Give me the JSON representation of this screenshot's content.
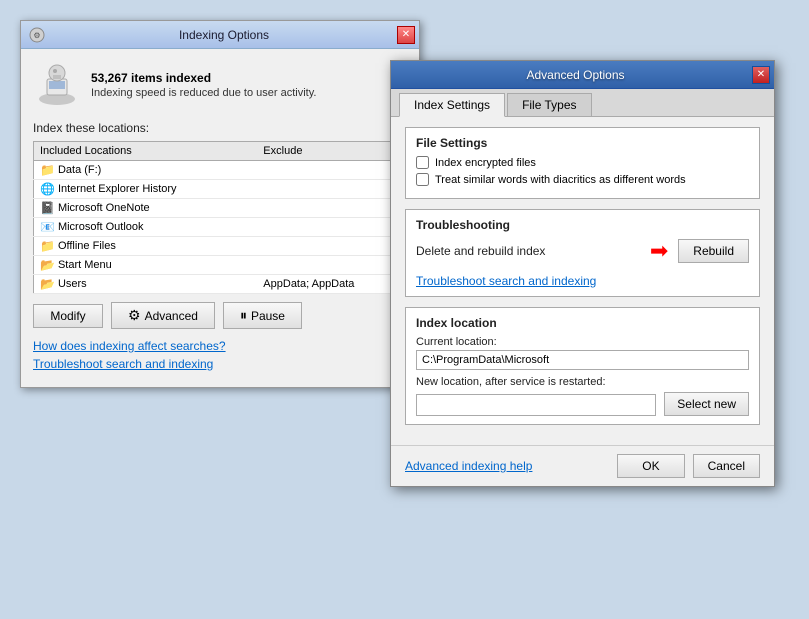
{
  "indexing_window": {
    "title": "Indexing Options",
    "close_btn": "✕",
    "items_indexed": "53,267 items indexed",
    "status_msg": "Indexing speed is reduced due to user activity.",
    "section_label": "Index these locations:",
    "col_included": "Included Locations",
    "col_exclude": "Exclude",
    "locations": [
      {
        "name": "Data (F:)",
        "icon": "folder",
        "exclude": ""
      },
      {
        "name": "Internet Explorer History",
        "icon": "ie",
        "exclude": ""
      },
      {
        "name": "Microsoft OneNote",
        "icon": "onenote",
        "exclude": ""
      },
      {
        "name": "Microsoft Outlook",
        "icon": "outlook",
        "exclude": ""
      },
      {
        "name": "Offline Files",
        "icon": "folder",
        "exclude": ""
      },
      {
        "name": "Start Menu",
        "icon": "folder-yellow",
        "exclude": ""
      },
      {
        "name": "Users",
        "icon": "folder-yellow",
        "exclude": "AppData; AppData"
      }
    ],
    "btn_modify": "Modify",
    "btn_advanced": "Advanced",
    "btn_advanced_icon": "⚙",
    "btn_pause": "Pause",
    "btn_pause_icon": "⏸",
    "link_how": "How does indexing affect searches?",
    "link_troubleshoot": "Troubleshoot search and indexing"
  },
  "advanced_window": {
    "title": "Advanced Options",
    "close_btn": "✕",
    "tabs": [
      {
        "label": "Index Settings",
        "active": true
      },
      {
        "label": "File Types",
        "active": false
      }
    ],
    "file_settings": {
      "title": "File Settings",
      "checkbox1_label": "Index encrypted files",
      "checkbox1_checked": false,
      "checkbox2_label": "Treat similar words with diacritics as different words",
      "checkbox2_checked": false
    },
    "troubleshooting": {
      "title": "Troubleshooting",
      "rebuild_label": "Delete and rebuild index",
      "rebuild_btn": "Rebuild",
      "link_troubleshoot": "Troubleshoot search and indexing"
    },
    "index_location": {
      "title": "Index location",
      "current_label": "Current location:",
      "current_value": "C:\\ProgramData\\Microsoft",
      "new_label": "New location, after service is restarted:",
      "new_value": "",
      "btn_select_new": "Select new"
    },
    "footer": {
      "link": "Advanced indexing help",
      "btn_ok": "OK",
      "btn_cancel": "Cancel"
    }
  }
}
